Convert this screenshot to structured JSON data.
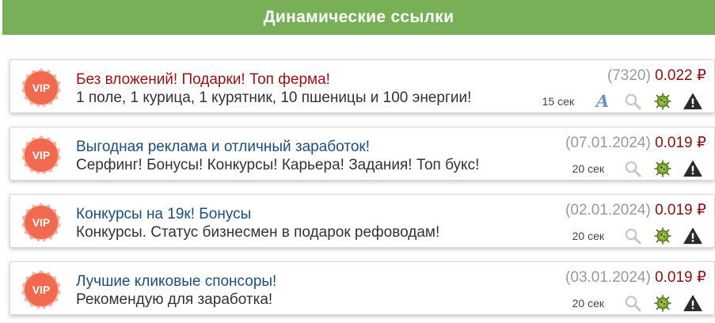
{
  "header": {
    "title": "Динамические ссылки"
  },
  "links": [
    {
      "badge": "VIP",
      "title": "Без вложений! Подарки! Топ ферма!",
      "title_color": "red",
      "description": "1 поле, 1 курица, 1 курятник, 10 пшеницы и 100 энергии!",
      "counter": "(7320)",
      "price": "0.022 ₽",
      "time": "15 сек",
      "icons": [
        "font-a-icon",
        "search-icon",
        "bug-icon",
        "warning-icon"
      ]
    },
    {
      "badge": "VIP",
      "title": "Выгодная реклама и отличный заработок!",
      "title_color": "blue",
      "description": "Серфинг! Бонусы! Конкурсы! Карьера! Задания! Топ букс!",
      "counter": "(07.01.2024)",
      "price": "0.019 ₽",
      "time": "20 сек",
      "icons": [
        "search-icon",
        "bug-icon",
        "warning-icon"
      ]
    },
    {
      "badge": "VIP",
      "title": "Конкурсы на 19к! Бонусы",
      "title_color": "blue",
      "description": "Конкурсы. Статус бизнесмен в подарок рефоводам!",
      "counter": "(02.01.2024)",
      "price": "0.019 ₽",
      "time": "20 сек",
      "icons": [
        "search-icon",
        "bug-icon",
        "warning-icon"
      ]
    },
    {
      "badge": "VIP",
      "title": "Лучшие кликовые спонсоры!",
      "title_color": "blue",
      "description": "Рекомендую для заработка!",
      "counter": "(03.01.2024)",
      "price": "0.019 ₽",
      "time": "20 сек",
      "icons": [
        "search-icon",
        "bug-icon",
        "warning-icon"
      ]
    }
  ],
  "colors": {
    "header_bg": "#78b058",
    "vip_badge": "#f16a4f",
    "title_red": "#a30f14",
    "title_blue": "#1d4e7e",
    "price": "#8e0e12"
  }
}
